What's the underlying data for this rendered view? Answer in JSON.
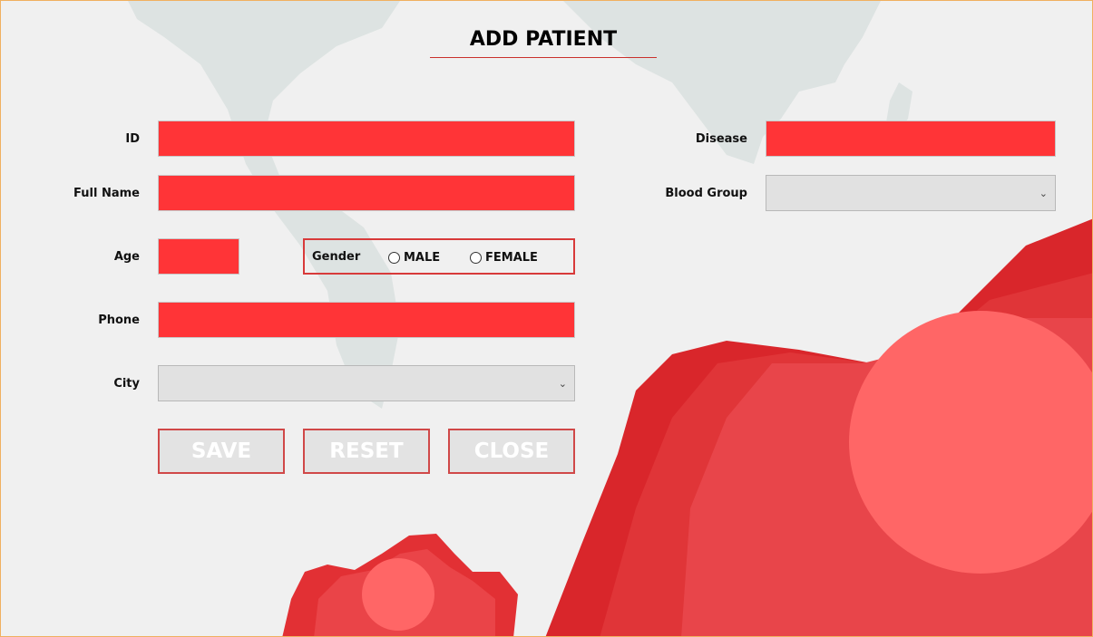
{
  "window": {
    "title": "ADD PATIENT"
  },
  "form": {
    "id_label": "ID",
    "fullname_label": "Full Name",
    "age_label": "Age",
    "phone_label": "Phone",
    "city_label": "City",
    "disease_label": "Disease",
    "bloodgroup_label": "Blood Group",
    "gender": {
      "label": "Gender",
      "options": [
        "MALE",
        "FEMALE"
      ]
    }
  },
  "buttons": {
    "save": "SAVE",
    "reset": "RESET",
    "close": "CLOSE"
  },
  "colors": {
    "field_fill": "#ff3437",
    "accent": "#d04848",
    "background": "#f0f0f0"
  }
}
